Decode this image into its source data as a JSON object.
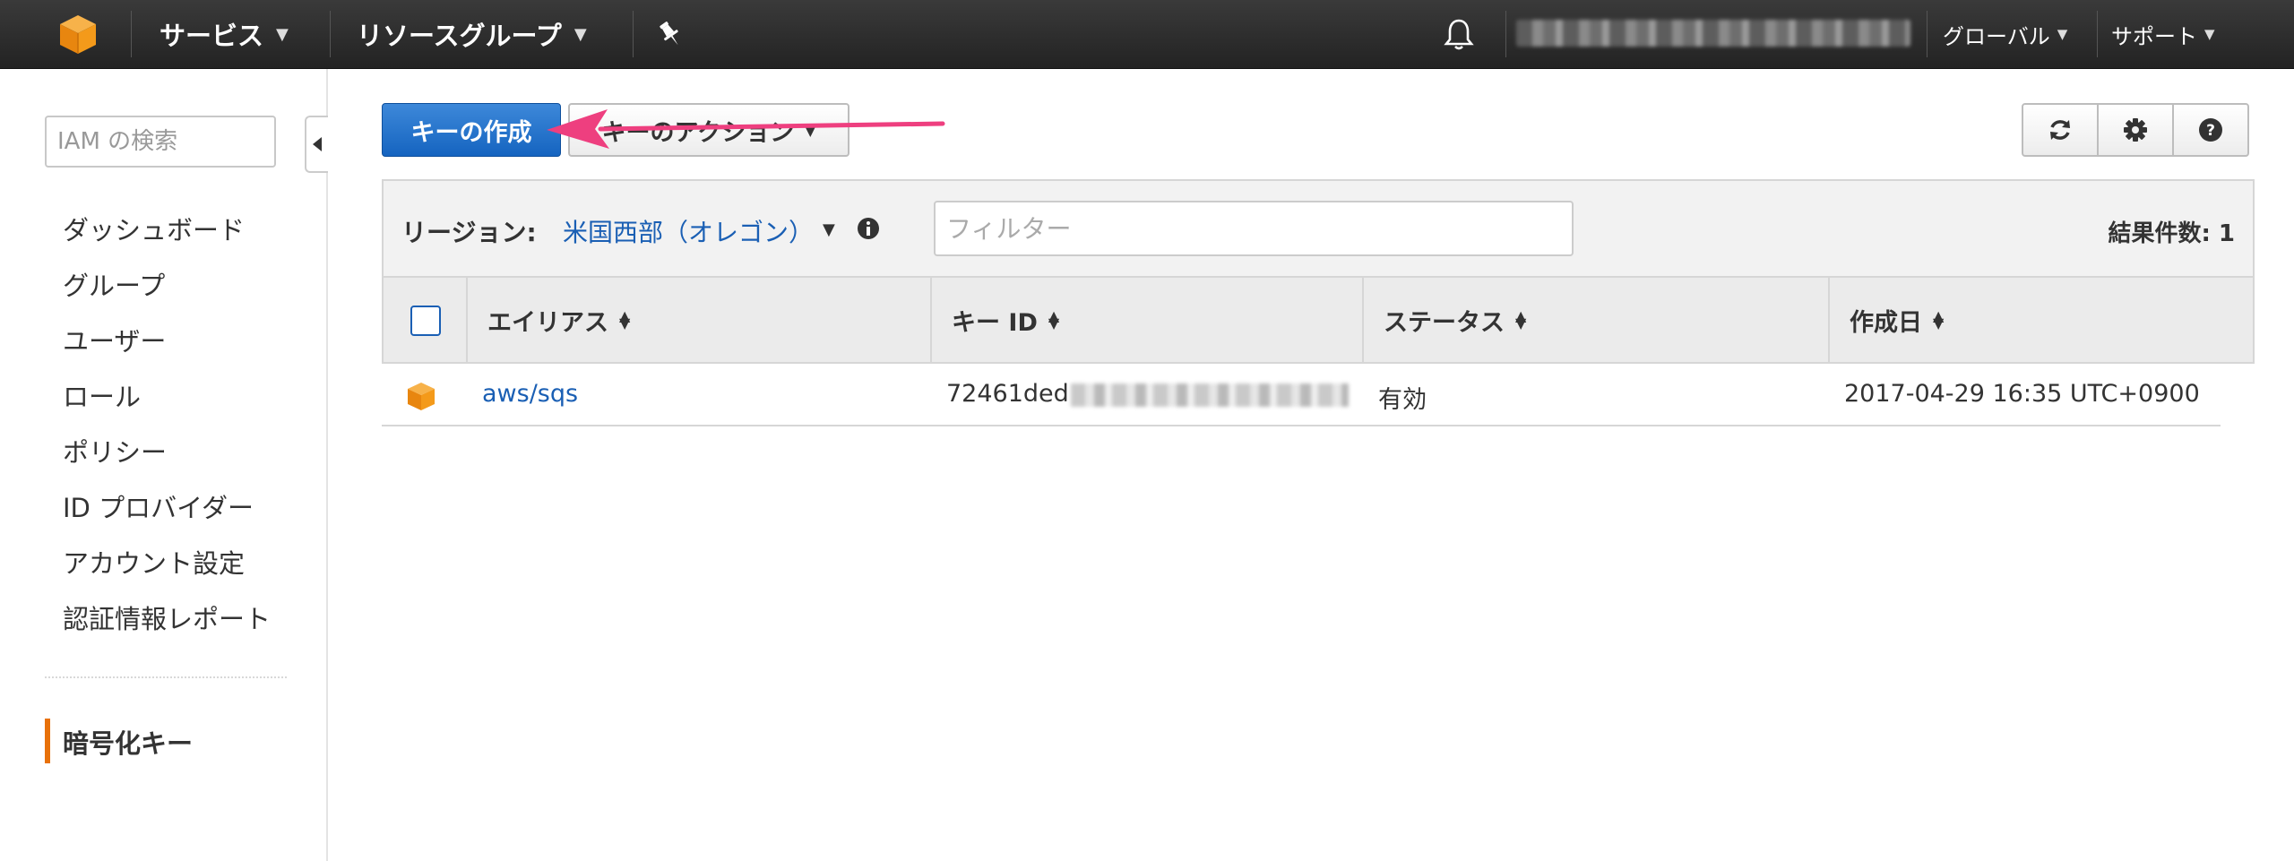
{
  "topbar": {
    "logo_icon": "aws-cube-icon",
    "services_label": "サービス",
    "resource_groups_label": "リソースグループ",
    "pin_icon": "pushpin-icon",
    "bell_icon": "bell-icon",
    "region_label": "グローバル",
    "support_label": "サポート"
  },
  "sidebar": {
    "search_placeholder": "IAM の検索",
    "items": [
      {
        "label": "ダッシュボード"
      },
      {
        "label": "グループ"
      },
      {
        "label": "ユーザー"
      },
      {
        "label": "ロール"
      },
      {
        "label": "ポリシー"
      },
      {
        "label": "ID プロバイダー"
      },
      {
        "label": "アカウント設定"
      },
      {
        "label": "認証情報レポート"
      }
    ],
    "active_item": "暗号化キー"
  },
  "toolbar": {
    "create_key_label": "キーの作成",
    "key_actions_label": "キーのアクション",
    "refresh_icon": "refresh-icon",
    "settings_icon": "gear-icon",
    "help_icon": "help-icon"
  },
  "filterbar": {
    "region_label": "リージョン:",
    "region_value": "米国西部（オレゴン）",
    "filter_placeholder": "フィルター",
    "result_count": "結果件数: 1"
  },
  "table": {
    "headers": {
      "alias": "エイリアス",
      "key_id": "キー ID",
      "status": "ステータス",
      "created": "作成日"
    },
    "rows": [
      {
        "alias": "aws/sqs",
        "key_id": "72461ded",
        "status": "有効",
        "created": "2017-04-29 16:35 UTC+0900"
      }
    ]
  },
  "colors": {
    "primary_button": "#1564c0",
    "link": "#1a5fb4",
    "active_marker": "#e8710a",
    "annotation_arrow": "#ee3f7f",
    "topbar": "#2b2b2b"
  }
}
